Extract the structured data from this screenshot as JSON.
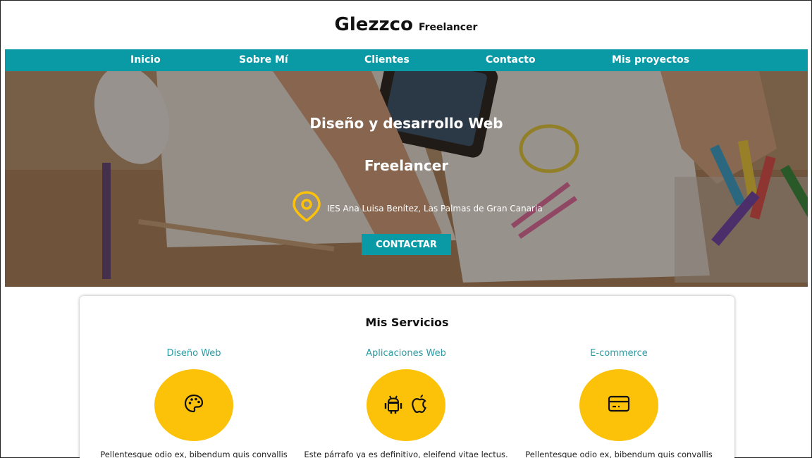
{
  "header": {
    "brand_name": "Glezzco",
    "brand_tag": "Freelancer"
  },
  "nav": {
    "items": [
      "Inicio",
      "Sobre Mí",
      "Clientes",
      "Contacto",
      "Mis proyectos"
    ]
  },
  "hero": {
    "title": "Diseño y desarrollo Web",
    "subtitle": "Freelancer",
    "location": "IES Ana Luisa Benítez, Las Palmas de Gran Canaria",
    "cta": "CONTACTAR"
  },
  "services": {
    "title": "Mis Servicios",
    "items": [
      {
        "name": "Diseño Web",
        "icon": "palette-icon",
        "desc": "Pellentesque odio ex, bibendum quis convallis"
      },
      {
        "name": "Aplicaciones Web",
        "icon": "android-apple-icon",
        "desc": "Este párrafo ya es definitivo, eleifend vitae lectus."
      },
      {
        "name": "E-commerce",
        "icon": "credit-card-icon",
        "desc": "Pellentesque odio ex, bibendum quis convallis"
      }
    ]
  },
  "colors": {
    "accent": "#0a9aa6",
    "icon_bg": "#fcc20a",
    "service_title": "#2a9ba3"
  }
}
